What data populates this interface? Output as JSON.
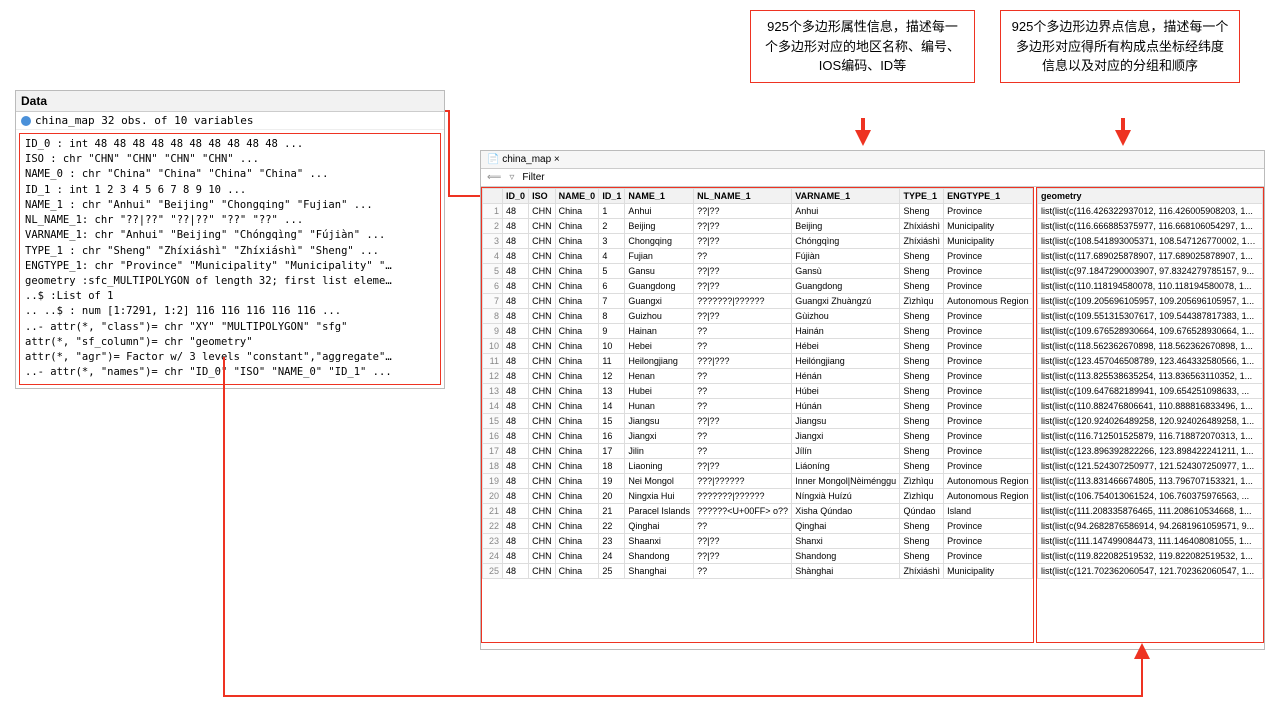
{
  "annotations": {
    "a1": "925个多边形属性信息，描述每一个多边形对应的地区名称、编号、IOS编码、ID等",
    "a2": "925个多边形边界点信息，描述每一个多边形对应得所有构成点坐标经纬度信息以及对应的分组和顺序"
  },
  "data_panel": {
    "title": "Data",
    "subtitle": "china_map        32 obs. of 10 variables",
    "body": "ID_0 : int 48 48 48 48 48 48 48 48 48 48 ...\nISO : chr \"CHN\" \"CHN\" \"CHN\" \"CHN\" ...\nNAME_0 : chr \"China\" \"China\" \"China\" \"China\" ...\nID_1 : int 1 2 3 4 5 6 7 8 9 10 ...\nNAME_1 : chr \"Anhui\" \"Beijing\" \"Chongqing\" \"Fujian\" ...\nNL_NAME_1: chr \"??|??\" \"??|??\" \"??\" \"??\" ...\nVARNAME_1: chr \"Anhui\" \"Beijing\" \"Chóngqìng\" \"Fújiàn\" ...\nTYPE_1 : chr \"Sheng\" \"Zhíxiáshì\" \"Zhíxiáshì\" \"Sheng\" ...\nENGTYPE_1: chr \"Province\" \"Municipality\" \"Municipality\" \"…\ngeometry :sfc_MULTIPOLYGON of length 32; first list eleme…\n..$ :List of 1\n.. ..$ : num [1:7291, 1:2] 116 116 116 116 116 ...\n..- attr(*, \"class\")= chr \"XY\" \"MULTIPOLYGON\" \"sfg\"\nattr(*, \"sf_column\")= chr \"geometry\"\nattr(*, \"agr\")= Factor w/ 3 levels \"constant\",\"aggregate\"…\n..- attr(*, \"names\")= chr \"ID_0\" \"ISO\" \"NAME_0\" \"ID_1\" ..."
  },
  "table": {
    "tab": "china_map",
    "filter_label": "Filter",
    "columns": [
      "",
      "ID_0",
      "ISO",
      "NAME_0",
      "ID_1",
      "NAME_1",
      "NL_NAME_1",
      "VARNAME_1",
      "TYPE_1",
      "ENGTYPE_1"
    ],
    "geo_col": "geometry",
    "rows": [
      {
        "n": 1,
        "ID_0": 48,
        "ISO": "CHN",
        "NAME_0": "China",
        "ID_1": 1,
        "NAME_1": "Anhui",
        "NL": "??|??",
        "VAR": "Anhui",
        "TYPE": "Sheng",
        "ENG": "Province",
        "geo": "list(list(c(116.426322937012, 116.426005908203, 1..."
      },
      {
        "n": 2,
        "ID_0": 48,
        "ISO": "CHN",
        "NAME_0": "China",
        "ID_1": 2,
        "NAME_1": "Beijing",
        "NL": "??|??",
        "VAR": "Beijing",
        "TYPE": "Zhíxiáshì",
        "ENG": "Municipality",
        "geo": "list(list(c(116.666885375977, 116.668106054297, 1..."
      },
      {
        "n": 3,
        "ID_0": 48,
        "ISO": "CHN",
        "NAME_0": "China",
        "ID_1": 3,
        "NAME_1": "Chongqing",
        "NL": "??|??",
        "VAR": "Chóngqìng",
        "TYPE": "Zhíxiáshì",
        "ENG": "Municipality",
        "geo": "list(list(c(108.541893005371, 108.547126770002, 10..."
      },
      {
        "n": 4,
        "ID_0": 48,
        "ISO": "CHN",
        "NAME_0": "China",
        "ID_1": 4,
        "NAME_1": "Fujian",
        "NL": "??",
        "VAR": "Fújiàn",
        "TYPE": "Sheng",
        "ENG": "Province",
        "geo": "list(list(c(117.689025878907, 117.689025878907, 1..."
      },
      {
        "n": 5,
        "ID_0": 48,
        "ISO": "CHN",
        "NAME_0": "China",
        "ID_1": 5,
        "NAME_1": "Gansu",
        "NL": "??|??",
        "VAR": "Gansù",
        "TYPE": "Sheng",
        "ENG": "Province",
        "geo": "list(list(c(97.1847290003907, 97.8324279785157, 9..."
      },
      {
        "n": 6,
        "ID_0": 48,
        "ISO": "CHN",
        "NAME_0": "China",
        "ID_1": 6,
        "NAME_1": "Guangdong",
        "NL": "??|??",
        "VAR": "Guangdong",
        "TYPE": "Sheng",
        "ENG": "Province",
        "geo": "list(list(c(110.118194580078, 110.118194580078, 1..."
      },
      {
        "n": 7,
        "ID_0": 48,
        "ISO": "CHN",
        "NAME_0": "China",
        "ID_1": 7,
        "NAME_1": "Guangxi",
        "NL": "???????|??????",
        "VAR": "Guangxi Zhuàngzú",
        "TYPE": "Zìzhìqu",
        "ENG": "Autonomous Region",
        "geo": "list(list(c(109.205696105957, 109.205696105957, 1..."
      },
      {
        "n": 8,
        "ID_0": 48,
        "ISO": "CHN",
        "NAME_0": "China",
        "ID_1": 8,
        "NAME_1": "Guizhou",
        "NL": "??|??",
        "VAR": "Gùizhou",
        "TYPE": "Sheng",
        "ENG": "Province",
        "geo": "list(list(c(109.551315307617, 109.544387817383, 1..."
      },
      {
        "n": 9,
        "ID_0": 48,
        "ISO": "CHN",
        "NAME_0": "China",
        "ID_1": 9,
        "NAME_1": "Hainan",
        "NL": "??",
        "VAR": "Hainán",
        "TYPE": "Sheng",
        "ENG": "Province",
        "geo": "list(list(c(109.676528930664, 109.676528930664, 1..."
      },
      {
        "n": 10,
        "ID_0": 48,
        "ISO": "CHN",
        "NAME_0": "China",
        "ID_1": 10,
        "NAME_1": "Hebei",
        "NL": "??",
        "VAR": "Hébei",
        "TYPE": "Sheng",
        "ENG": "Province",
        "geo": "list(list(c(118.562362670898, 118.562362670898, 1..."
      },
      {
        "n": 11,
        "ID_0": 48,
        "ISO": "CHN",
        "NAME_0": "China",
        "ID_1": 11,
        "NAME_1": "Heilongjiang",
        "NL": "???|???",
        "VAR": "Heilóngjiang",
        "TYPE": "Sheng",
        "ENG": "Province",
        "geo": "list(list(c(123.457046508789, 123.464332580566, 1..."
      },
      {
        "n": 12,
        "ID_0": 48,
        "ISO": "CHN",
        "NAME_0": "China",
        "ID_1": 12,
        "NAME_1": "Henan",
        "NL": "??",
        "VAR": "Hénán",
        "TYPE": "Sheng",
        "ENG": "Province",
        "geo": "list(list(c(113.825538635254, 113.836563110352, 1..."
      },
      {
        "n": 13,
        "ID_0": 48,
        "ISO": "CHN",
        "NAME_0": "China",
        "ID_1": 13,
        "NAME_1": "Hubei",
        "NL": "??",
        "VAR": "Húbei",
        "TYPE": "Sheng",
        "ENG": "Province",
        "geo": "list(list(c(109.647682189941, 109.654251098633, ..."
      },
      {
        "n": 14,
        "ID_0": 48,
        "ISO": "CHN",
        "NAME_0": "China",
        "ID_1": 14,
        "NAME_1": "Hunan",
        "NL": "??",
        "VAR": "Húnán",
        "TYPE": "Sheng",
        "ENG": "Province",
        "geo": "list(list(c(110.882476806641, 110.888816833496, 1..."
      },
      {
        "n": 15,
        "ID_0": 48,
        "ISO": "CHN",
        "NAME_0": "China",
        "ID_1": 15,
        "NAME_1": "Jiangsu",
        "NL": "??|??",
        "VAR": "Jiangsu",
        "TYPE": "Sheng",
        "ENG": "Province",
        "geo": "list(list(c(120.924026489258, 120.924026489258, 1..."
      },
      {
        "n": 16,
        "ID_0": 48,
        "ISO": "CHN",
        "NAME_0": "China",
        "ID_1": 16,
        "NAME_1": "Jiangxi",
        "NL": "??",
        "VAR": "Jiangxi",
        "TYPE": "Sheng",
        "ENG": "Province",
        "geo": "list(list(c(116.712501525879, 116.718872070313, 1..."
      },
      {
        "n": 17,
        "ID_0": 48,
        "ISO": "CHN",
        "NAME_0": "China",
        "ID_1": 17,
        "NAME_1": "Jilin",
        "NL": "??",
        "VAR": "Jílín",
        "TYPE": "Sheng",
        "ENG": "Province",
        "geo": "list(list(c(123.896392822266, 123.898422241211, 1..."
      },
      {
        "n": 18,
        "ID_0": 48,
        "ISO": "CHN",
        "NAME_0": "China",
        "ID_1": 18,
        "NAME_1": "Liaoning",
        "NL": "??|??",
        "VAR": "Liáoníng",
        "TYPE": "Sheng",
        "ENG": "Province",
        "geo": "list(list(c(121.524307250977, 121.524307250977, 1..."
      },
      {
        "n": 19,
        "ID_0": 48,
        "ISO": "CHN",
        "NAME_0": "China",
        "ID_1": 19,
        "NAME_1": "Nei Mongol",
        "NL": "???|??????",
        "VAR": "Inner Mongol|Nèiménggu",
        "TYPE": "Zìzhìqu",
        "ENG": "Autonomous Region",
        "geo": "list(list(c(113.831466674805, 113.796707153321, 1..."
      },
      {
        "n": 20,
        "ID_0": 48,
        "ISO": "CHN",
        "NAME_0": "China",
        "ID_1": 20,
        "NAME_1": "Ningxia Hui",
        "NL": "???????|??????",
        "VAR": "Níngxià Huízú",
        "TYPE": "Zìzhìqu",
        "ENG": "Autonomous Region",
        "geo": "list(list(c(106.754013061524, 106.760375976563, ..."
      },
      {
        "n": 21,
        "ID_0": 48,
        "ISO": "CHN",
        "NAME_0": "China",
        "ID_1": 21,
        "NAME_1": "Paracel Islands",
        "NL": "??????<U+00FF> o??",
        "VAR": "Xisha Qúndao",
        "TYPE": "Qúndao",
        "ENG": "Island",
        "geo": "list(list(c(111.208335876465, 111.208610534668, 1..."
      },
      {
        "n": 22,
        "ID_0": 48,
        "ISO": "CHN",
        "NAME_0": "China",
        "ID_1": 22,
        "NAME_1": "Qinghai",
        "NL": "??",
        "VAR": "Qinghai",
        "TYPE": "Sheng",
        "ENG": "Province",
        "geo": "list(list(c(94.2682876586914, 94.2681961059571, 9..."
      },
      {
        "n": 23,
        "ID_0": 48,
        "ISO": "CHN",
        "NAME_0": "China",
        "ID_1": 23,
        "NAME_1": "Shaanxi",
        "NL": "??|??",
        "VAR": "Shanxi",
        "TYPE": "Sheng",
        "ENG": "Province",
        "geo": "list(list(c(111.147499084473, 111.146408081055, 1..."
      },
      {
        "n": 24,
        "ID_0": 48,
        "ISO": "CHN",
        "NAME_0": "China",
        "ID_1": 24,
        "NAME_1": "Shandong",
        "NL": "??|??",
        "VAR": "Shandong",
        "TYPE": "Sheng",
        "ENG": "Province",
        "geo": "list(list(c(119.822082519532, 119.822082519532, 1..."
      },
      {
        "n": 25,
        "ID_0": 48,
        "ISO": "CHN",
        "NAME_0": "China",
        "ID_1": 25,
        "NAME_1": "Shanghai",
        "NL": "??",
        "VAR": "Shànghai",
        "TYPE": "Zhíxiáshì",
        "ENG": "Municipality",
        "geo": "list(list(c(121.702362060547, 121.702362060547, 1..."
      }
    ]
  }
}
